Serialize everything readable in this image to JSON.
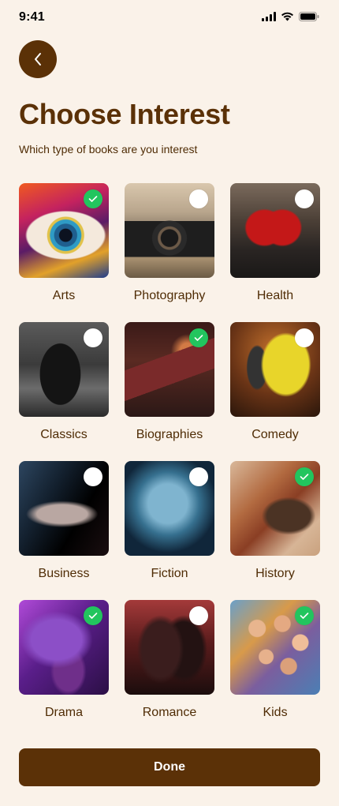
{
  "status_bar": {
    "time": "9:41",
    "icons": [
      "signal-icon",
      "wifi-icon",
      "battery-icon"
    ]
  },
  "header": {
    "back_icon": "chevron-left-icon",
    "title": "Choose Interest",
    "subtitle": "Which type of books are you interest"
  },
  "interests": [
    {
      "label": "Arts",
      "selected": true,
      "image": "arts"
    },
    {
      "label": "Photography",
      "selected": false,
      "image": "photography"
    },
    {
      "label": "Health",
      "selected": false,
      "image": "health"
    },
    {
      "label": "Classics",
      "selected": false,
      "image": "classics"
    },
    {
      "label": "Biographies",
      "selected": true,
      "image": "biographies"
    },
    {
      "label": "Comedy",
      "selected": false,
      "image": "comedy"
    },
    {
      "label": "Business",
      "selected": false,
      "image": "business"
    },
    {
      "label": "Fiction",
      "selected": false,
      "image": "fiction"
    },
    {
      "label": "History",
      "selected": true,
      "image": "history"
    },
    {
      "label": "Drama",
      "selected": true,
      "image": "drama"
    },
    {
      "label": "Romance",
      "selected": false,
      "image": "romance"
    },
    {
      "label": "Kids",
      "selected": true,
      "image": "kids"
    }
  ],
  "done_button": {
    "label": "Done"
  },
  "colors": {
    "background": "#faf2e9",
    "primary": "#5b3107",
    "text": "#4f2c05",
    "check_selected": "#22c55e",
    "check_unselected": "#ffffff"
  }
}
